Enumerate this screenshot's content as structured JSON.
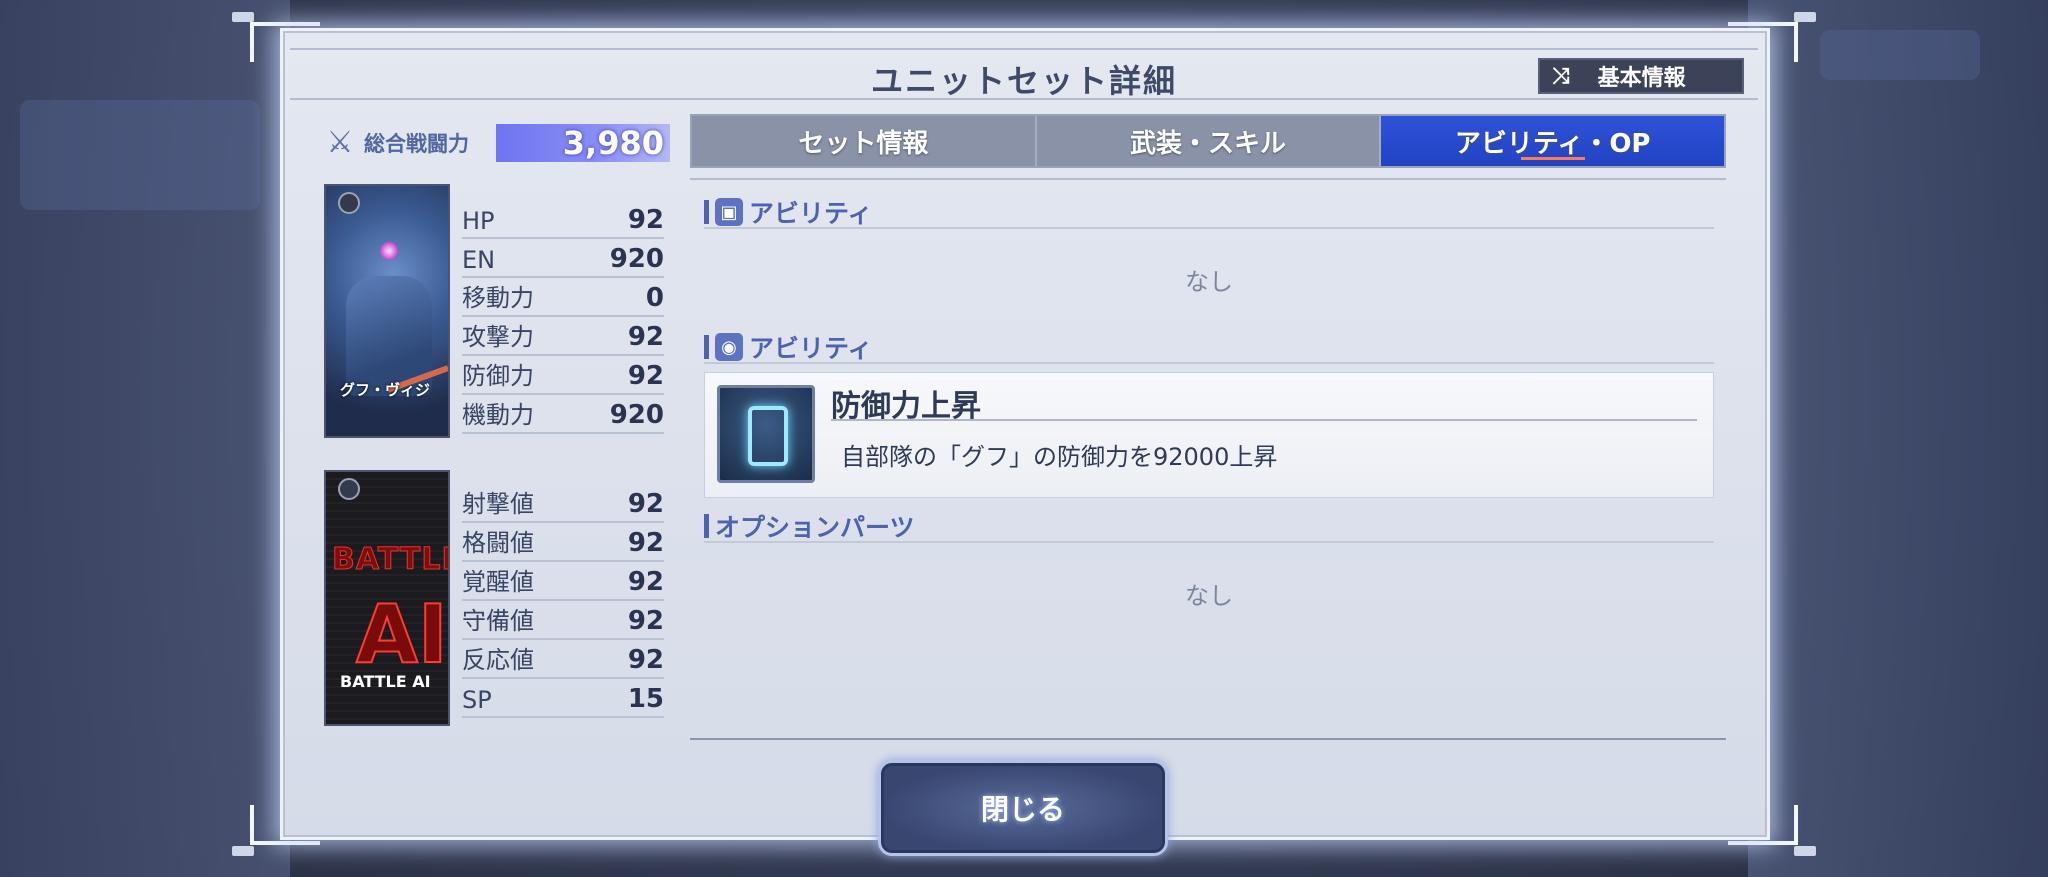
{
  "dialog": {
    "title": "ユニットセット詳細",
    "basic_info_label": "基本情報",
    "close_label": "閉じる"
  },
  "summary": {
    "power_label": "総合戦闘力",
    "power_value": "3,980"
  },
  "unit_card": {
    "name": "グフ・ヴィジ"
  },
  "ai_card": {
    "title": "BATTLE",
    "big_text": "AI",
    "label": "BATTLE AI"
  },
  "unit_stats": [
    {
      "label": "HP",
      "value": "92"
    },
    {
      "label": "EN",
      "value": "920"
    },
    {
      "label": "移動力",
      "value": "0"
    },
    {
      "label": "攻撃力",
      "value": "92"
    },
    {
      "label": "防御力",
      "value": "92"
    },
    {
      "label": "機動力",
      "value": "920"
    }
  ],
  "pilot_stats": [
    {
      "label": "射撃値",
      "value": "92"
    },
    {
      "label": "格闘値",
      "value": "92"
    },
    {
      "label": "覚醒値",
      "value": "92"
    },
    {
      "label": "守備値",
      "value": "92"
    },
    {
      "label": "反応値",
      "value": "92"
    },
    {
      "label": "SP",
      "value": "15"
    }
  ],
  "tabs": [
    {
      "label": "セット情報",
      "active": false
    },
    {
      "label": "武装・スキル",
      "active": false
    },
    {
      "label": "アビリティ・OP",
      "active": true
    }
  ],
  "sections": {
    "unit_ability": {
      "title": "アビリティ",
      "empty_text": "なし"
    },
    "pilot_ability": {
      "title": "アビリティ",
      "item_name": "防御力上昇",
      "item_desc": "自部隊の「グフ」の防御力を92000上昇"
    },
    "option_parts": {
      "title": "オプションパーツ",
      "empty_text": "なし"
    }
  },
  "colors": {
    "active_tab": "#2143c4",
    "accent": "#4d63ad",
    "power_bar": "#6f74f0"
  }
}
